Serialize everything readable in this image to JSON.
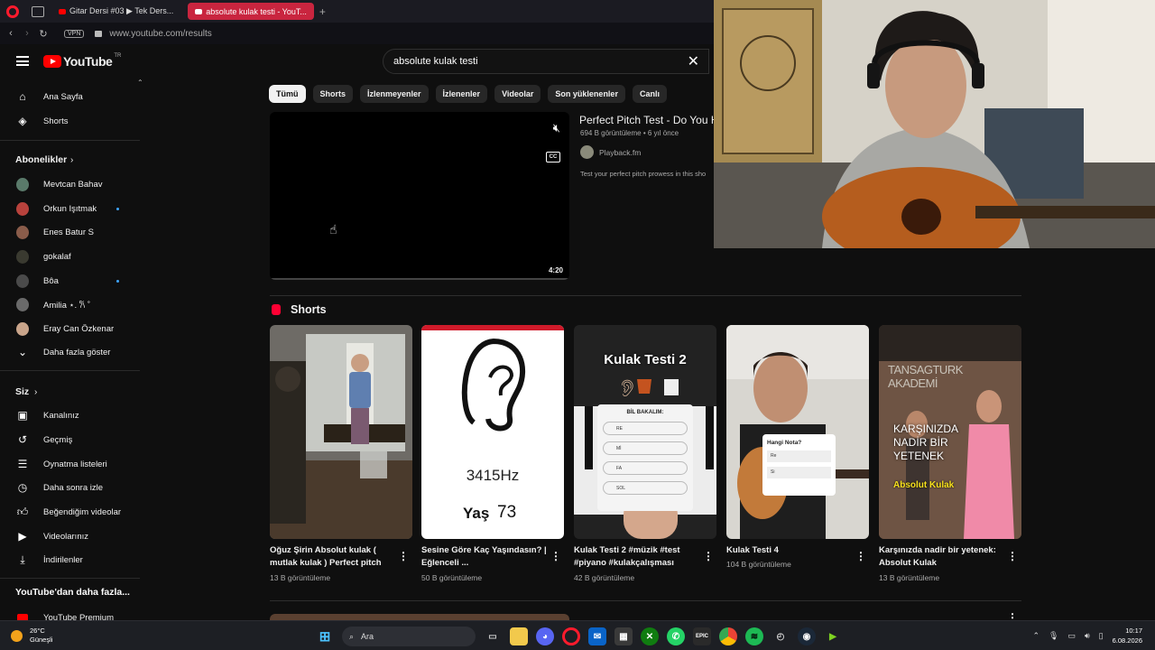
{
  "browser": {
    "tabs": [
      {
        "label": "Gitar Dersi #03 ▶ Tek Ders..."
      },
      {
        "label": "absolute kulak testi - YouT..."
      }
    ],
    "vpn_label": "VPN",
    "url": "www.youtube.com/results"
  },
  "youtube": {
    "logo_text": "YouTube",
    "country_code": "TR",
    "search_query": "absolute kulak testi"
  },
  "sidebar": {
    "main": [
      {
        "label": "Ana Sayfa",
        "icon": "home-icon"
      },
      {
        "label": "Shorts",
        "icon": "shorts-icon"
      }
    ],
    "subscriptions_header": "Abonelikler",
    "subscriptions": [
      {
        "label": "Mevtcan Bahav",
        "new": false
      },
      {
        "label": "Orkun Işıtmak",
        "new": true
      },
      {
        "label": "Enes Batur S",
        "new": false
      },
      {
        "label": "gokalaf",
        "new": false
      },
      {
        "label": "Bôa",
        "new": true
      },
      {
        "label": "Amilia ⋆. 𐙚 ˚",
        "new": false
      },
      {
        "label": "Eray Can Özkenar",
        "new": false
      }
    ],
    "show_more": "Daha fazla göster",
    "you_header": "Siz",
    "you_items": [
      {
        "label": "Kanalınız",
        "icon": "channel-icon"
      },
      {
        "label": "Geçmiş",
        "icon": "history-icon"
      },
      {
        "label": "Oynatma listeleri",
        "icon": "playlist-icon"
      },
      {
        "label": "Daha sonra izle",
        "icon": "clock-icon"
      },
      {
        "label": "Beğendiğim videolar",
        "icon": "like-icon"
      },
      {
        "label": "Videolarınız",
        "icon": "video-icon"
      },
      {
        "label": "İndirilenler",
        "icon": "download-icon"
      }
    ],
    "more_header": "YouTube'dan daha fazla...",
    "premium": "YouTube Premium"
  },
  "chips": [
    "Tümü",
    "Shorts",
    "İzlenmeyenler",
    "İzlenenler",
    "Videolar",
    "Son yüklenenler",
    "Canlı"
  ],
  "video": {
    "title": "Perfect Pitch Test - Do You H",
    "meta": "694 B görüntüleme • 6 yıl önce",
    "channel": "Playback.fm",
    "description": "Test your perfect pitch prowess in this sho",
    "duration": "4:20"
  },
  "shorts": {
    "header": "Shorts",
    "items": [
      {
        "title": "Oğuz Şirin Absolut kulak ( mutlak kulak ) Perfect pitch",
        "views": "13 B görüntüleme"
      },
      {
        "title": "Sesine Göre Kaç Yaşındasın? | Eğlenceli ...",
        "views": "50 B görüntüleme",
        "thumb_freq": "3415Hz",
        "thumb_age_label": "Yaş",
        "thumb_age": "73"
      },
      {
        "title": "Kulak Testi 2 #müzik #test #piyano #kulakçalışması",
        "views": "42 B görüntüleme",
        "thumb_title": "Kulak Testi 2",
        "thumb_sub": "BİL BAKALIM:",
        "thumb_options": [
          "RE",
          "Mİ",
          "FA",
          "SOL"
        ]
      },
      {
        "title": "Kulak Testi 4",
        "views": "104 B görüntüleme",
        "thumb_question": "Hangi Nota?",
        "thumb_options": [
          "Re",
          "Si"
        ]
      },
      {
        "title": "Karşınızda nadir bir yetenek: Absolut Kulak",
        "views": "13 B görüntüleme",
        "thumb_brand": "TANSAGTURK AKADEMİ",
        "thumb_text": "KARŞINIZDA NADİR BİR YETENEK",
        "thumb_highlight": "Absolut Kulak"
      }
    ]
  },
  "taskbar": {
    "temperature": "26°C",
    "weather": "Güneşli",
    "search_label": "Ara",
    "time": "10:17",
    "date": "6.08.2026"
  },
  "colors": {
    "accent": "#ff0000",
    "tab_active": "#c9253f",
    "new_dot": "#3ea6ff"
  }
}
